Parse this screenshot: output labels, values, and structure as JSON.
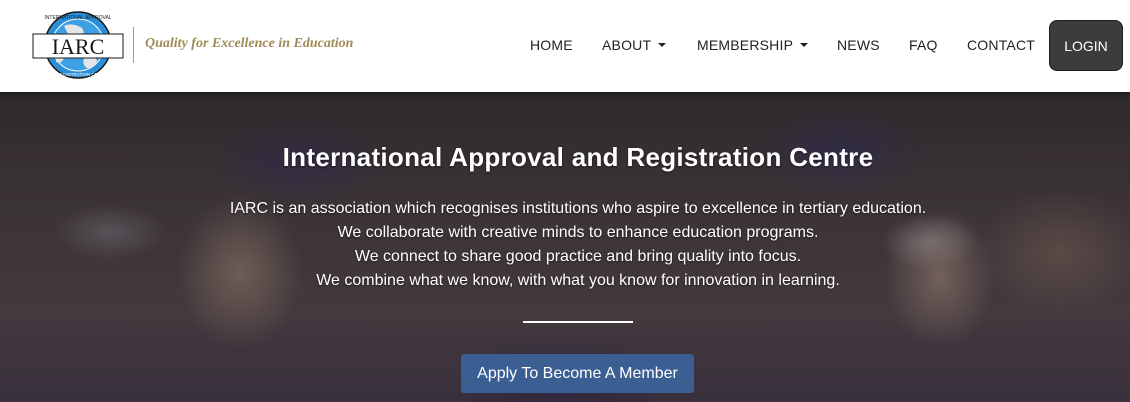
{
  "header": {
    "logo": {
      "text": "IARC",
      "ring_text_top": "INTERNATIONAL APPROVAL",
      "ring_text_bottom": "AND REGISTRATION CENTRE",
      "colors": {
        "globe": "#2a8fd8",
        "land": "#e6e6e6",
        "band": "#ffffff",
        "border": "#1a1a1a"
      }
    },
    "tagline": "Quality for Excellence in Education",
    "tagline_color": "#a08a55"
  },
  "nav": {
    "items": [
      {
        "label": "HOME",
        "has_dropdown": false
      },
      {
        "label": "ABOUT",
        "has_dropdown": true
      },
      {
        "label": "MEMBERSHIP",
        "has_dropdown": true
      },
      {
        "label": "NEWS",
        "has_dropdown": false
      },
      {
        "label": "FAQ",
        "has_dropdown": false
      },
      {
        "label": "CONTACT",
        "has_dropdown": false
      }
    ],
    "login_label": "LOGIN",
    "login_color": "#3c3c3c"
  },
  "hero": {
    "title": "International Approval and Registration Centre",
    "lines": [
      "IARC is an association which recognises institutions who aspire to excellence in tertiary education.",
      "We collaborate with creative minds to enhance education programs.",
      "We connect to share good practice and bring quality into focus.",
      "We combine what we know, with what you know for innovation in learning."
    ],
    "cta_label": "Apply To Become A Member",
    "cta_color": "#3b5e93",
    "background": "graduation-crowd-photo"
  }
}
